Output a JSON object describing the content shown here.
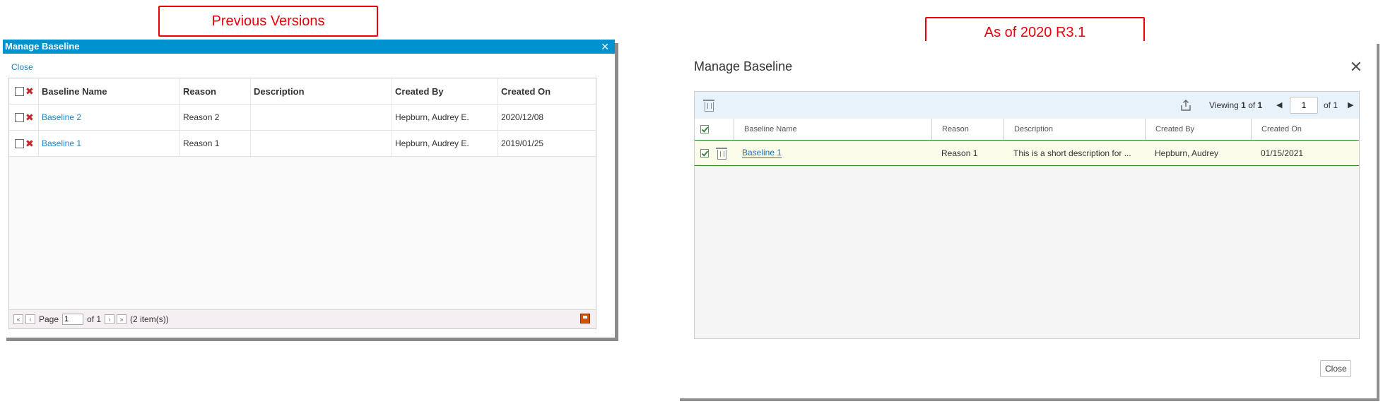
{
  "callouts": {
    "previous": "Previous Versions",
    "current": "As of 2020 R3.1"
  },
  "old_dialog": {
    "title": "Manage Baseline",
    "close_link": "Close",
    "columns": [
      "Baseline Name",
      "Reason",
      "Description",
      "Created By",
      "Created On"
    ],
    "rows": [
      {
        "name": "Baseline 2",
        "reason": "Reason 2",
        "description": "",
        "created_by": "Hepburn, Audrey E.",
        "created_on": "2020/12/08"
      },
      {
        "name": "Baseline 1",
        "reason": "Reason 1",
        "description": "",
        "created_by": "Hepburn, Audrey E.",
        "created_on": "2019/01/25"
      }
    ],
    "pager": {
      "page_label": "Page",
      "page_value": "1",
      "of_label": "of 1",
      "items": "(2 item(s))"
    },
    "colors": {
      "titlebar": "#0092cf",
      "link": "#1b86c6",
      "delete": "#c0282b"
    }
  },
  "new_dialog": {
    "title": "Manage Baseline",
    "toolbar": {
      "viewing_prefix": "Viewing",
      "viewing_current": "1",
      "viewing_of": "of",
      "viewing_total": "1",
      "page_value": "1",
      "of_total": "of 1"
    },
    "columns": [
      "Baseline Name",
      "Reason",
      "Description",
      "Created By",
      "Created On"
    ],
    "rows": [
      {
        "name": "Baseline 1",
        "reason": "Reason 1",
        "description": "This is a short description for ...",
        "created_by": "Hepburn, Audrey",
        "created_on": "01/15/2021"
      }
    ],
    "close_button": "Close",
    "colors": {
      "toolbar": "#e8f2fa",
      "selected_row": "#fbfbe9",
      "border_accent": "#2c7a2c",
      "link": "#1d6fb8"
    }
  }
}
